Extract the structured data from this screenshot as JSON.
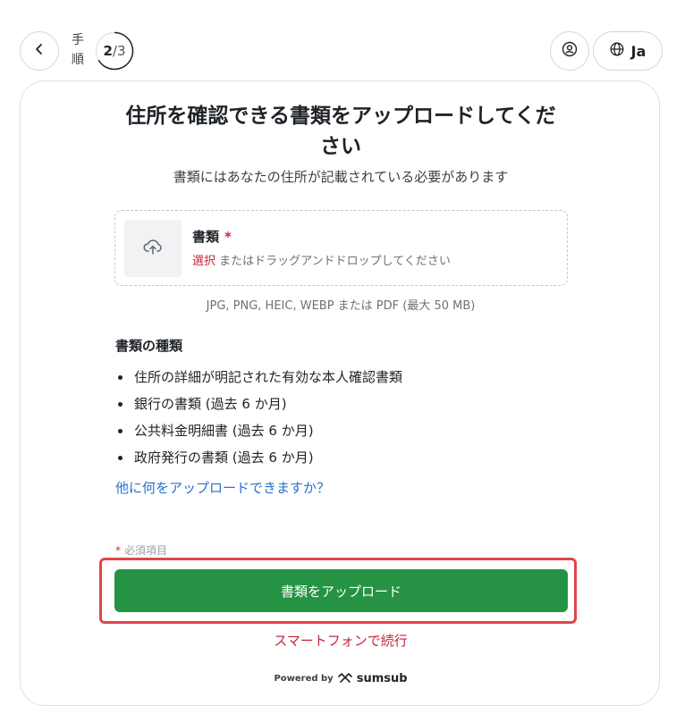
{
  "header": {
    "step_label": "手順",
    "step_current": "2",
    "step_separator": "/",
    "step_total": "3",
    "language": "Ja",
    "icons": {
      "back": "chevron-left-icon",
      "profile": "user-circle-icon",
      "language": "globe-icon"
    }
  },
  "card": {
    "title": "住所を確認できる書類をアップロードしてください",
    "subtitle": "書類にはあなたの住所が記載されている必要があります",
    "dropzone": {
      "label": "書類",
      "required_mark": "*",
      "select_text": "選択",
      "hint_text": " またはドラッグアンドドロップしてください",
      "icon": "cloud-upload-icon"
    },
    "formats": "JPG, PNG, HEIC, WEBP または PDF (最大 50 MB)",
    "types_heading": "書類の種類",
    "types": [
      "住所の詳細が明記された有効な本人確認書類",
      "銀行の書類 (過去 6 か月)",
      "公共料金明細書 (過去 6 か月)",
      "政府発行の書類 (過去 6 か月)"
    ],
    "more_link": "他に何をアップロードできますか？",
    "required_note_star": "*",
    "required_note": "必須項目",
    "upload_button": "書類をアップロード",
    "phone_link": "スマートフォンで続行",
    "powered_by": "Powered by",
    "brand": "sumsub"
  },
  "colors": {
    "accent_green": "#259343",
    "required_red": "#d0283d",
    "link_blue": "#2a6fce",
    "highlight_red": "#e0454a"
  }
}
